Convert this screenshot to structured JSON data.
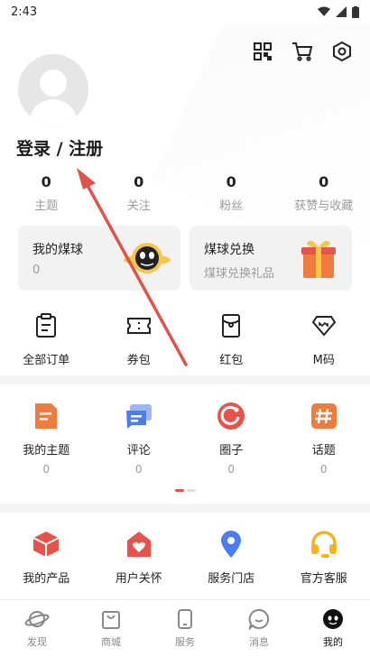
{
  "status_bar": {
    "time": "2:43"
  },
  "header": {
    "login_label": "登录 / 注册"
  },
  "stats": [
    {
      "count": "0",
      "label": "主题"
    },
    {
      "count": "0",
      "label": "关注"
    },
    {
      "count": "0",
      "label": "粉丝"
    },
    {
      "count": "0",
      "label": "获赞与收藏"
    }
  ],
  "cards": {
    "my_coins": {
      "title": "我的煤球",
      "value": "0"
    },
    "exchange": {
      "title": "煤球兑换",
      "subtitle": "煤球兑换礼品"
    }
  },
  "orders": [
    {
      "label": "全部订单",
      "icon": "clipboard-icon"
    },
    {
      "label": "券包",
      "icon": "ticket-icon"
    },
    {
      "label": "红包",
      "icon": "red-envelope-icon"
    },
    {
      "label": "M码",
      "icon": "m-code-icon"
    }
  ],
  "community": [
    {
      "label": "我的主题",
      "count": "0",
      "icon": "document-icon",
      "color": "#f07b3f"
    },
    {
      "label": "评论",
      "count": "0",
      "icon": "comment-icon",
      "color": "#4a7cf3"
    },
    {
      "label": "圈子",
      "count": "0",
      "icon": "circle-icon",
      "color": "#e5534b"
    },
    {
      "label": "话题",
      "count": "0",
      "icon": "hashtag-icon",
      "color": "#f07b3f"
    }
  ],
  "services": [
    {
      "label": "我的产品",
      "icon": "product-box-icon",
      "color": "#e5534b"
    },
    {
      "label": "用户关怀",
      "icon": "care-heart-icon",
      "color": "#e5534b"
    },
    {
      "label": "服务门店",
      "icon": "location-pin-icon",
      "color": "#4a7cf3"
    },
    {
      "label": "官方客服",
      "icon": "headset-icon",
      "color": "#f5b323"
    }
  ],
  "tabbar": [
    {
      "label": "发现",
      "icon": "planet-icon",
      "active": false
    },
    {
      "label": "商城",
      "icon": "shopping-bag-icon",
      "active": false
    },
    {
      "label": "服务",
      "icon": "phone-icon",
      "active": false
    },
    {
      "label": "消息",
      "icon": "chat-bubble-icon",
      "active": false
    },
    {
      "label": "我的",
      "icon": "profile-face-icon",
      "active": true
    }
  ],
  "colors": {
    "accent_red": "#e5534b",
    "arrow_red": "#e0534a"
  }
}
